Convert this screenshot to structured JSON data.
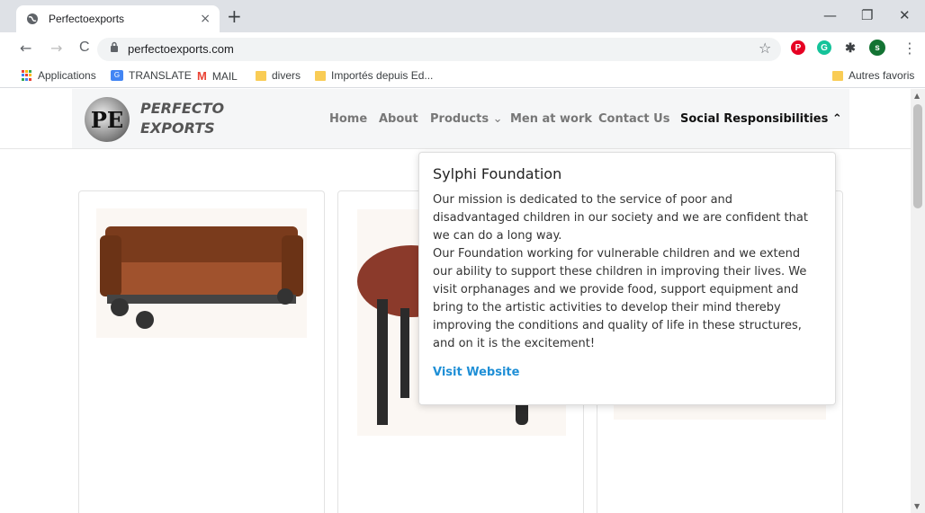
{
  "browser": {
    "tab_title": "Perfectoexports",
    "tab_close": "×",
    "new_tab": "+",
    "url": "perfectoexports.com",
    "profile_initial": "s",
    "minimize": "—",
    "maximize": "❐",
    "close": "✕",
    "back": "←",
    "forward": "→",
    "reload": "C",
    "lock": "🔒",
    "star": "☆",
    "kebab": "⋮"
  },
  "bookmarks": [
    {
      "label": "Applications",
      "icon": "apps-grid-icon"
    },
    {
      "label": "TRANSLATE",
      "icon": "translate-icon"
    },
    {
      "label": "MAIL",
      "icon": "gmail-icon"
    },
    {
      "label": "divers",
      "icon": "folder-icon"
    },
    {
      "label": "Importés depuis Ed...",
      "icon": "folder-icon"
    }
  ],
  "bookmarks_other": "Autres favoris",
  "site": {
    "logo_initials": "PE",
    "logo_line1": "PERFECTO",
    "logo_line2": "EXPORTS",
    "nav": [
      "Home",
      "About",
      "Products",
      "Men at work",
      "Contact Us",
      "Social Responsibilities"
    ],
    "chevron_down": "⌄",
    "chevron_up": "⌃"
  },
  "dropdown": {
    "title": "Sylphi Foundation",
    "p1": "Our mission is dedicated to the service of poor and disadvantaged children in our society and we are confident that we can do a long way.",
    "p2": "Our Foundation working for vulnerable children and we extend our ability to support these children in improving their lives. We visit orphanages and we provide food, support equipment and bring to the artistic activities to develop their mind thereby improving the conditions and quality of life in these structures, and on it is the excitement!",
    "link": "Visit Website"
  },
  "colors": {
    "link": "#1f8fd6",
    "nav_active": "#111111",
    "nav_inactive": "#777777",
    "pinterest": "#e60023",
    "grammarly": "#15c39a",
    "profile": "#137333"
  }
}
